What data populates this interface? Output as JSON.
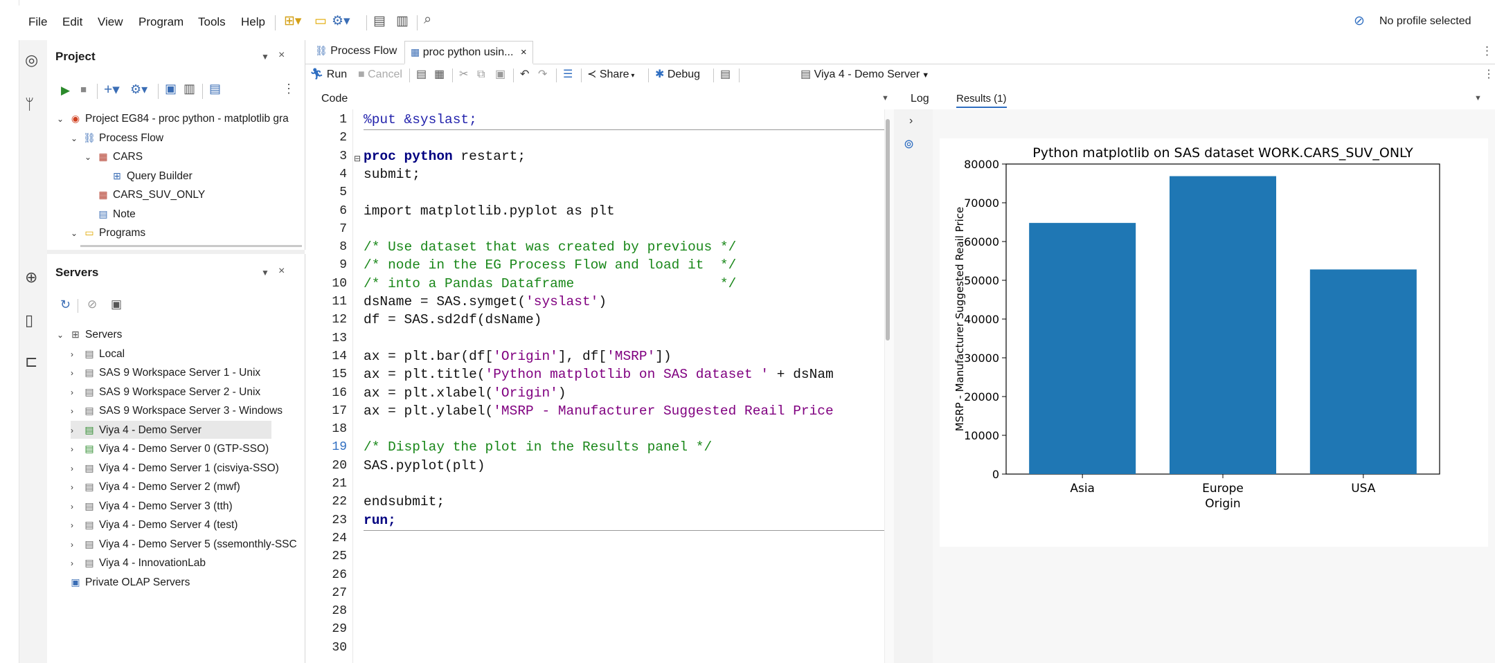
{
  "menu": {
    "file": "File",
    "edit": "Edit",
    "view": "View",
    "program": "Program",
    "tools": "Tools",
    "help": "Help"
  },
  "profile": {
    "label": "No profile selected"
  },
  "project_panel": {
    "title": "Project",
    "tree": [
      {
        "label": "Project EG84 - proc python - matplotlib gra",
        "icon": "project-icon",
        "level": 0,
        "chevron": "v"
      },
      {
        "label": "Process Flow",
        "icon": "process-flow-icon",
        "level": 1,
        "chevron": "v"
      },
      {
        "label": "CARS",
        "icon": "dataset-icon",
        "level": 2,
        "chevron": "v"
      },
      {
        "label": "Query Builder",
        "icon": "query-builder-icon",
        "level": 3,
        "chevron": ""
      },
      {
        "label": "CARS_SUV_ONLY",
        "icon": "dataset-icon",
        "level": 2,
        "chevron": ""
      },
      {
        "label": "Note",
        "icon": "note-icon",
        "level": 2,
        "chevron": ""
      },
      {
        "label": "Programs",
        "icon": "folder-icon",
        "level": 1,
        "chevron": "v"
      }
    ]
  },
  "servers_panel": {
    "title": "Servers",
    "tree": [
      {
        "label": "Servers",
        "level": 0,
        "chevron": "v",
        "icon": "servers-icon"
      },
      {
        "label": "Local",
        "level": 1,
        "chevron": ">",
        "icon": "server-icon"
      },
      {
        "label": "SAS 9 Workspace Server 1 - Unix",
        "level": 1,
        "chevron": ">",
        "icon": "server-icon"
      },
      {
        "label": "SAS 9 Workspace Server 2 - Unix",
        "level": 1,
        "chevron": ">",
        "icon": "server-icon"
      },
      {
        "label": "SAS 9 Workspace Server 3 - Windows",
        "level": 1,
        "chevron": ">",
        "icon": "server-icon"
      },
      {
        "label": "Viya 4 - Demo Server",
        "level": 1,
        "chevron": ">",
        "icon": "server-connected-icon",
        "selected": true
      },
      {
        "label": "Viya 4 - Demo Server 0 (GTP-SSO)",
        "level": 1,
        "chevron": ">",
        "icon": "server-connected-icon"
      },
      {
        "label": "Viya 4 - Demo Server 1 (cisviya-SSO)",
        "level": 1,
        "chevron": ">",
        "icon": "server-icon"
      },
      {
        "label": "Viya 4 - Demo Server 2 (mwf)",
        "level": 1,
        "chevron": ">",
        "icon": "server-icon"
      },
      {
        "label": "Viya 4 - Demo Server 3 (tth)",
        "level": 1,
        "chevron": ">",
        "icon": "server-icon"
      },
      {
        "label": "Viya 4 - Demo Server 4 (test)",
        "level": 1,
        "chevron": ">",
        "icon": "server-icon"
      },
      {
        "label": "Viya 4 - Demo Server 5 (ssemonthly-SSC",
        "level": 1,
        "chevron": ">",
        "icon": "server-icon"
      },
      {
        "label": "Viya 4 - InnovationLab",
        "level": 1,
        "chevron": ">",
        "icon": "server-icon"
      },
      {
        "label": "Private OLAP Servers",
        "level": 0,
        "chevron": "",
        "icon": "olap-icon"
      }
    ]
  },
  "tabs": [
    {
      "label": "Process Flow",
      "icon": "process-flow-icon",
      "active": false
    },
    {
      "label": "proc python usin...",
      "icon": "program-icon",
      "active": true
    }
  ],
  "editor_toolbar": {
    "run": "Run",
    "cancel": "Cancel",
    "share": "Share",
    "debug": "Debug",
    "server": "Viya 4 - Demo Server"
  },
  "code_pane": {
    "title": "Code",
    "lines": [
      [
        {
          "t": "%put &syslast;",
          "c": "macro"
        }
      ],
      [],
      [
        {
          "t": "proc python",
          "c": "kw"
        },
        {
          "t": " restart;",
          "c": "plain"
        }
      ],
      [
        {
          "t": "submit;",
          "c": "plain"
        }
      ],
      [],
      [
        {
          "t": "import matplotlib.pyplot as plt",
          "c": "plain"
        }
      ],
      [],
      [
        {
          "t": "/* Use dataset that was created by previous */",
          "c": "cm"
        }
      ],
      [
        {
          "t": "/* node in the EG Process Flow and load it  */",
          "c": "cm"
        }
      ],
      [
        {
          "t": "/* into a Pandas Dataframe                  */",
          "c": "cm"
        }
      ],
      [
        {
          "t": "dsName = SAS.symget(",
          "c": "plain"
        },
        {
          "t": "'syslast'",
          "c": "str"
        },
        {
          "t": ")",
          "c": "plain"
        }
      ],
      [
        {
          "t": "df = SAS.sd2df(dsName)",
          "c": "plain"
        }
      ],
      [],
      [
        {
          "t": "ax = plt.bar(df[",
          "c": "plain"
        },
        {
          "t": "'Origin'",
          "c": "str"
        },
        {
          "t": "], df[",
          "c": "plain"
        },
        {
          "t": "'MSRP'",
          "c": "str"
        },
        {
          "t": "])",
          "c": "plain"
        }
      ],
      [
        {
          "t": "ax = plt.title(",
          "c": "plain"
        },
        {
          "t": "'Python matplotlib on SAS dataset '",
          "c": "str"
        },
        {
          "t": " + dsNam",
          "c": "plain"
        }
      ],
      [
        {
          "t": "ax = plt.xlabel(",
          "c": "plain"
        },
        {
          "t": "'Origin'",
          "c": "str"
        },
        {
          "t": ")",
          "c": "plain"
        }
      ],
      [
        {
          "t": "ax = plt.ylabel(",
          "c": "plain"
        },
        {
          "t": "'MSRP - Manufacturer Suggested Reail Price",
          "c": "str"
        }
      ],
      [],
      [
        {
          "t": "/* Display the plot in the Results panel */",
          "c": "cm"
        }
      ],
      [
        {
          "t": "SAS.pyplot(plt)",
          "c": "plain"
        }
      ],
      [],
      [
        {
          "t": "endsubmit;",
          "c": "plain"
        }
      ],
      [
        {
          "t": "run;",
          "c": "kw"
        }
      ],
      [],
      [],
      [],
      [],
      [],
      [],
      []
    ],
    "line_numbers": [
      "1",
      "2",
      "3",
      "4",
      "5",
      "6",
      "7",
      "8",
      "9",
      "10",
      "11",
      "12",
      "13",
      "14",
      "15",
      "16",
      "17",
      "18",
      "19",
      "20",
      "21",
      "22",
      "23",
      "24",
      "25",
      "26",
      "27",
      "28",
      "29",
      "30"
    ]
  },
  "result_tabs": {
    "log": "Log",
    "results": "Results (1)"
  },
  "chart_data": {
    "type": "bar",
    "title": "Python matplotlib on SAS dataset WORK.CARS_SUV_ONLY",
    "xlabel": "Origin",
    "ylabel": "MSRP - Manufacturer Suggested Reail Price",
    "categories": [
      "Asia",
      "Europe",
      "USA"
    ],
    "values": [
      64800,
      76870,
      52795
    ],
    "ylim": [
      0,
      80000
    ],
    "yticks": [
      "0",
      "10000",
      "20000",
      "30000",
      "40000",
      "50000",
      "60000",
      "70000",
      "80000"
    ],
    "color": "#1f77b4"
  }
}
